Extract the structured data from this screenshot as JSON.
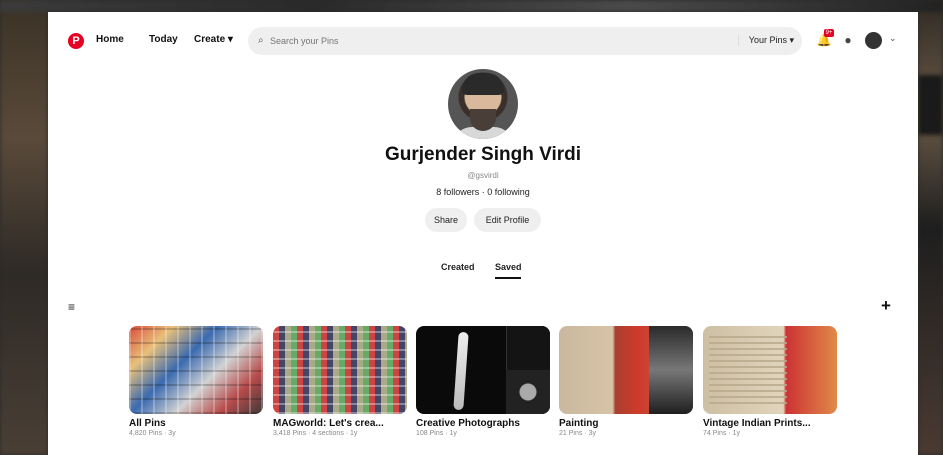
{
  "header": {
    "logo_glyph": "P",
    "nav": {
      "home": "Home",
      "today": "Today",
      "create": "Create ▾"
    },
    "search": {
      "placeholder": "Search your Pins",
      "filter": "Your Pins ▾"
    },
    "notifications_badge": "9+"
  },
  "profile": {
    "name": "Gurjender Singh Virdi",
    "username": "@gsvirdi",
    "follow_stats": "8 followers · 0 following",
    "share_label": "Share",
    "edit_label": "Edit Profile"
  },
  "tabs": {
    "created": "Created",
    "saved": "Saved"
  },
  "toolbar": {
    "filter_icon": "≡",
    "add_icon": "+"
  },
  "boards": [
    {
      "title": "All Pins",
      "meta": "4,820 Pins · 3y"
    },
    {
      "title": "MAGworld: Let's crea...",
      "meta": "3,418 Pins · 4 sections · 1y"
    },
    {
      "title": "Creative Photographs",
      "meta": "108 Pins · 1y"
    },
    {
      "title": "Painting",
      "meta": "21 Pins · 3y"
    },
    {
      "title": "Vintage Indian Prints...",
      "meta": "74 Pins · 1y"
    }
  ],
  "colors": {
    "brand": "#e60023",
    "surface": "#efefef"
  }
}
